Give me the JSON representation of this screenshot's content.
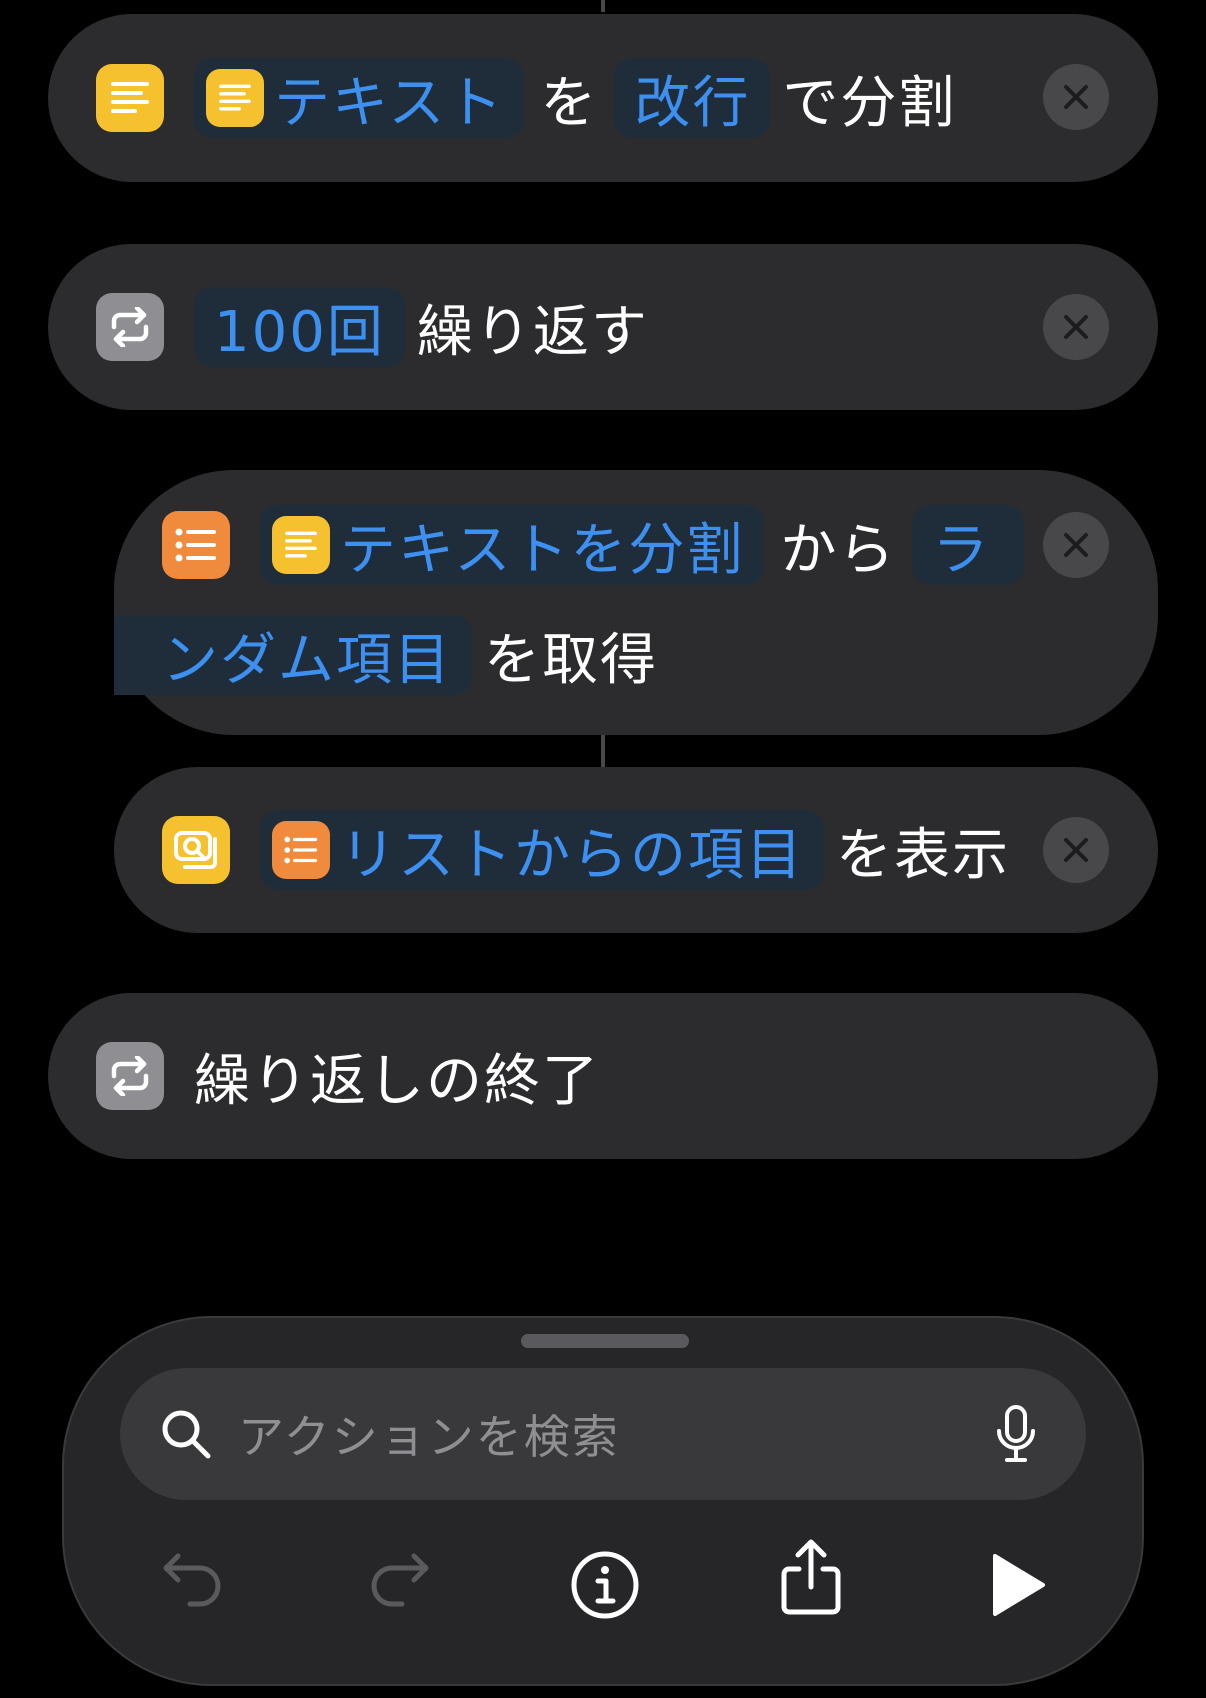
{
  "actions": [
    {
      "name": "split-text",
      "icon": "text-lines-icon",
      "tokens": [
        {
          "type": "variable",
          "icon": "text-lines-icon",
          "text": "テキスト"
        },
        {
          "type": "label",
          "text": "を"
        },
        {
          "type": "parameter",
          "text": "改行"
        },
        {
          "type": "label",
          "text": "で分割"
        }
      ]
    },
    {
      "name": "repeat",
      "icon": "repeat-icon",
      "tokens": [
        {
          "type": "parameter",
          "text": "100回"
        },
        {
          "type": "label",
          "text": "繰り返す"
        }
      ]
    },
    {
      "name": "get-item-from-list",
      "icon": "list-icon",
      "tokens": [
        {
          "type": "variable",
          "icon": "text-lines-icon",
          "text": "テキストを分割"
        },
        {
          "type": "label",
          "text": "から"
        },
        {
          "type": "parameter",
          "text_line1": "ラ",
          "text_line2": "ンダム項目"
        },
        {
          "type": "label",
          "text": "を取得"
        }
      ]
    },
    {
      "name": "show-result",
      "icon": "show-result-icon",
      "tokens": [
        {
          "type": "variable",
          "icon": "list-icon",
          "text": "リストからの項目"
        },
        {
          "type": "label",
          "text": "を表示"
        }
      ]
    },
    {
      "name": "end-repeat",
      "icon": "repeat-icon",
      "tokens": [
        {
          "type": "label",
          "text": "繰り返しの終了"
        }
      ]
    }
  ],
  "search": {
    "placeholder": "アクションを検索",
    "icon": "search-icon",
    "mic_icon": "microphone-icon"
  },
  "toolbar": {
    "buttons": [
      "undo-icon",
      "redo-icon",
      "info-icon",
      "share-icon",
      "play-icon"
    ]
  },
  "colors": {
    "background": "#000000",
    "card": "#2c2c2e",
    "token_text": "#3d8ff0",
    "token_bg": "#1f2c3a",
    "yellow_icon": "#f5c12e",
    "orange_icon": "#f08a3c",
    "gray_icon": "#8e8e93"
  }
}
